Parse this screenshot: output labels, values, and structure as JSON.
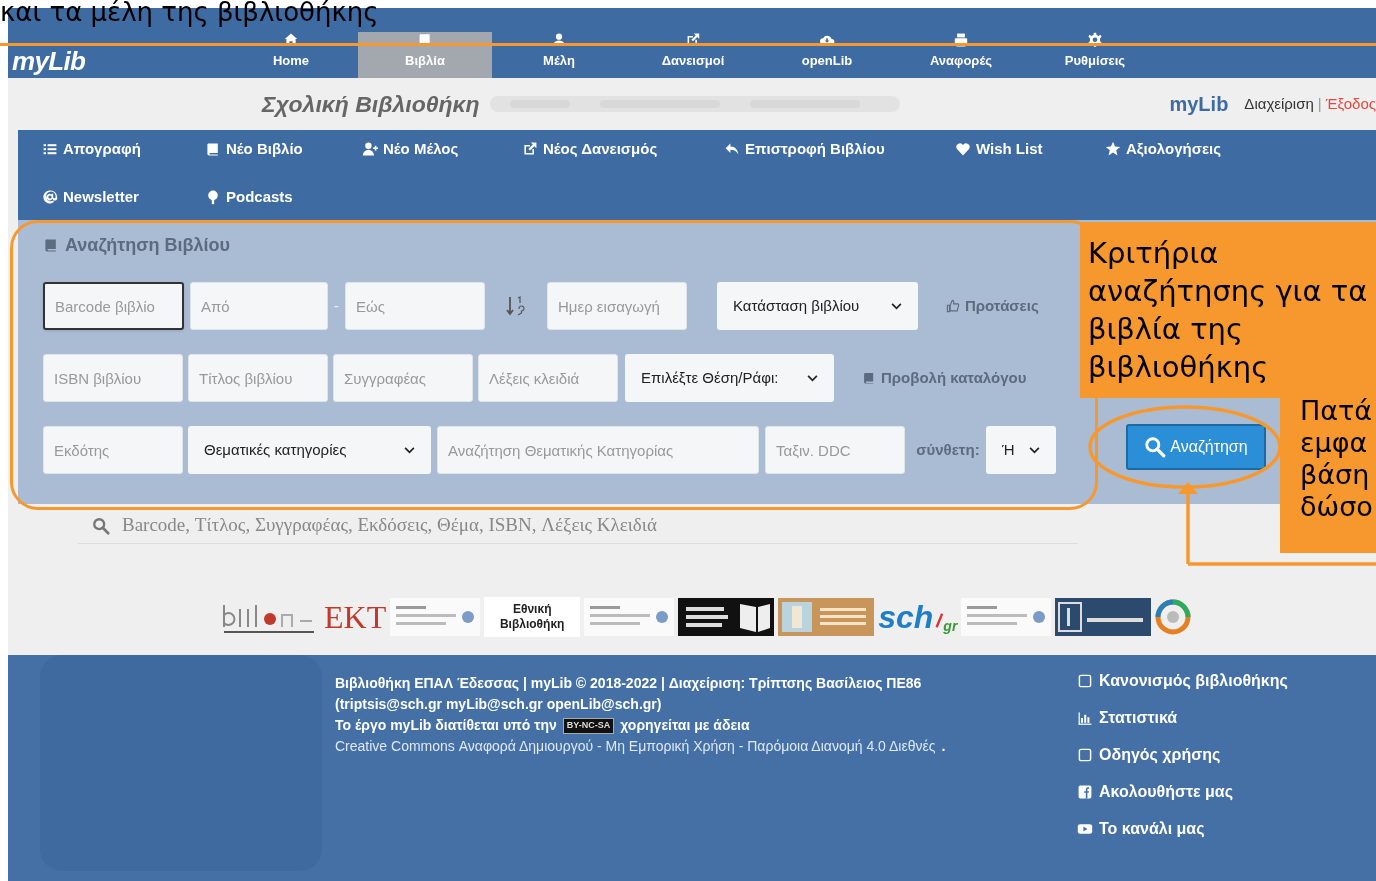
{
  "annotation_top": {
    "text": "και τα μέλη της βιβλιοθήκης"
  },
  "nav": {
    "logo": "myLib",
    "items": [
      {
        "label": "Home",
        "kind": "home",
        "selected": false
      },
      {
        "label": "Βιβλία",
        "kind": "book",
        "selected": true
      },
      {
        "label": "Μέλη",
        "kind": "user",
        "selected": false
      },
      {
        "label": "Δανεισμοί",
        "kind": "external",
        "selected": false
      },
      {
        "label": "openLib",
        "kind": "cloud",
        "selected": false
      },
      {
        "label": "Αναφορές",
        "kind": "print",
        "selected": false
      },
      {
        "label": "Ρυθμίσεις",
        "kind": "gear",
        "selected": false
      }
    ]
  },
  "header": {
    "title": "Σχολική Βιβλιοθήκη",
    "brand": "myLib",
    "links": [
      "Διαχείριση",
      "Έξοδος"
    ],
    "separator": "|"
  },
  "menu": {
    "rows": [
      [
        {
          "label": "Απογραφή",
          "kind": "list"
        },
        {
          "label": "Νέο Βιβλίο",
          "kind": "book"
        },
        {
          "label": "Νέο Μέλος",
          "kind": "user-plus"
        },
        {
          "label": "Νέος Δανεισμός",
          "kind": "external"
        },
        {
          "label": "Επιστροφή Βιβλίου",
          "kind": "reply"
        },
        {
          "label": "Wish List",
          "kind": "heart"
        },
        {
          "label": "Αξιολογήσεις",
          "kind": "star"
        }
      ],
      [
        {
          "label": "Newsletter",
          "kind": "at"
        },
        {
          "label": "Podcasts",
          "kind": "podcast"
        }
      ]
    ]
  },
  "search_panel": {
    "title": "Αναζήτηση Βιβλίου",
    "lines": [
      {
        "fields": [
          {
            "kind": "input",
            "placeholder": "Barcode βιβλίο",
            "focused": true
          },
          {
            "kind": "input",
            "placeholder": "Από",
            "focused": false
          },
          {
            "kind": "dash",
            "text": "-"
          },
          {
            "kind": "input",
            "placeholder": "Εώς",
            "focused": false
          },
          {
            "kind": "sort"
          },
          {
            "kind": "input",
            "placeholder": "Ημερ εισαγωγή",
            "focused": false
          },
          {
            "kind": "select",
            "value": "Κατάσταση βιβλίου"
          },
          {
            "kind": "link",
            "text": "Προτάσεις"
          }
        ]
      },
      {
        "fields": [
          {
            "kind": "input",
            "placeholder": "ISBN βιβλίου",
            "focused": false
          },
          {
            "kind": "input",
            "placeholder": "Τίτλος βιβλίου",
            "focused": false
          },
          {
            "kind": "input",
            "placeholder": "Συγγραφέας",
            "focused": false
          },
          {
            "kind": "input",
            "placeholder": "Λέξεις κλειδιά",
            "focused": false
          },
          {
            "kind": "select",
            "value": "Επιλέξτε Θέση/Ράφι:"
          },
          {
            "kind": "link",
            "text": "Προβολή καταλόγου"
          }
        ]
      },
      {
        "fields": [
          {
            "kind": "input",
            "placeholder": "Εκδότης",
            "focused": false
          },
          {
            "kind": "select",
            "value": "Θεματικές κατηγορίες"
          },
          {
            "kind": "input",
            "placeholder": "Αναζήτηση Θεματικής Κατηγορίας",
            "focused": false
          },
          {
            "kind": "input",
            "placeholder": "Ταξιν. DDC",
            "focused": false
          },
          {
            "kind": "label",
            "text": "σύνθετη:"
          },
          {
            "kind": "select",
            "value": "Ή"
          }
        ]
      }
    ],
    "button": "Αναζήτηση"
  },
  "callouts": [
    "Κριτήρια αναζήτησης για τα βιβλία της βιβλιοθήκης",
    "Πατά εμφα βάση δώσο"
  ],
  "quick_search": {
    "placeholder": "Barcode, Τίτλος, Συγγραφέας, Εκδόσεις, Θέμα, ISBN, Λέξεις Κλειδιά"
  },
  "partners": [
    {
      "kind": "art-net"
    },
    {
      "kind": "wordmark-serif",
      "text": "EKT"
    },
    {
      "kind": "art-light"
    },
    {
      "kind": "wordmark-stack",
      "text": "Εθνική Βιβλιοθήκη"
    },
    {
      "kind": "art-light"
    },
    {
      "kind": "art-dark"
    },
    {
      "kind": "art-tan"
    },
    {
      "kind": "wordmark-sch",
      "text": "sch",
      "domain": "gr"
    },
    {
      "kind": "art-light"
    },
    {
      "kind": "art-navy"
    },
    {
      "kind": "art-round"
    }
  ],
  "footer": {
    "credit": "Βιβλιοθήκη ΕΠΑΛ Έδεσσας | myLib © 2018-2022 | Διαχείριση: Τρίπτσης Βασίλειος ΠΕ86 (triptsis@sch.gr myLib@sch.gr openLib@sch.gr)",
    "license_before": "Το έργο **myLib** διατίθεται υπό την",
    "badge": "BY-NC-SA",
    "license_after": "χορηγείται με άδεια",
    "license_link": "Creative Commons Αναφορά Δημιουργού - Μη Εμπορική Χρήση - Παρόμοια Διανομή 4.0 Διεθνές",
    "license_end": ".",
    "links": [
      {
        "label": "Κανονισμός βιβλιοθήκης",
        "kind": "doc"
      },
      {
        "label": "Στατιστικά",
        "kind": "chart"
      },
      {
        "label": "Οδηγός χρήσης",
        "kind": "doc"
      },
      {
        "label": "Ακολουθήστε μας",
        "kind": "facebook"
      },
      {
        "label": "Το κανάλι μας",
        "kind": "video"
      }
    ]
  }
}
